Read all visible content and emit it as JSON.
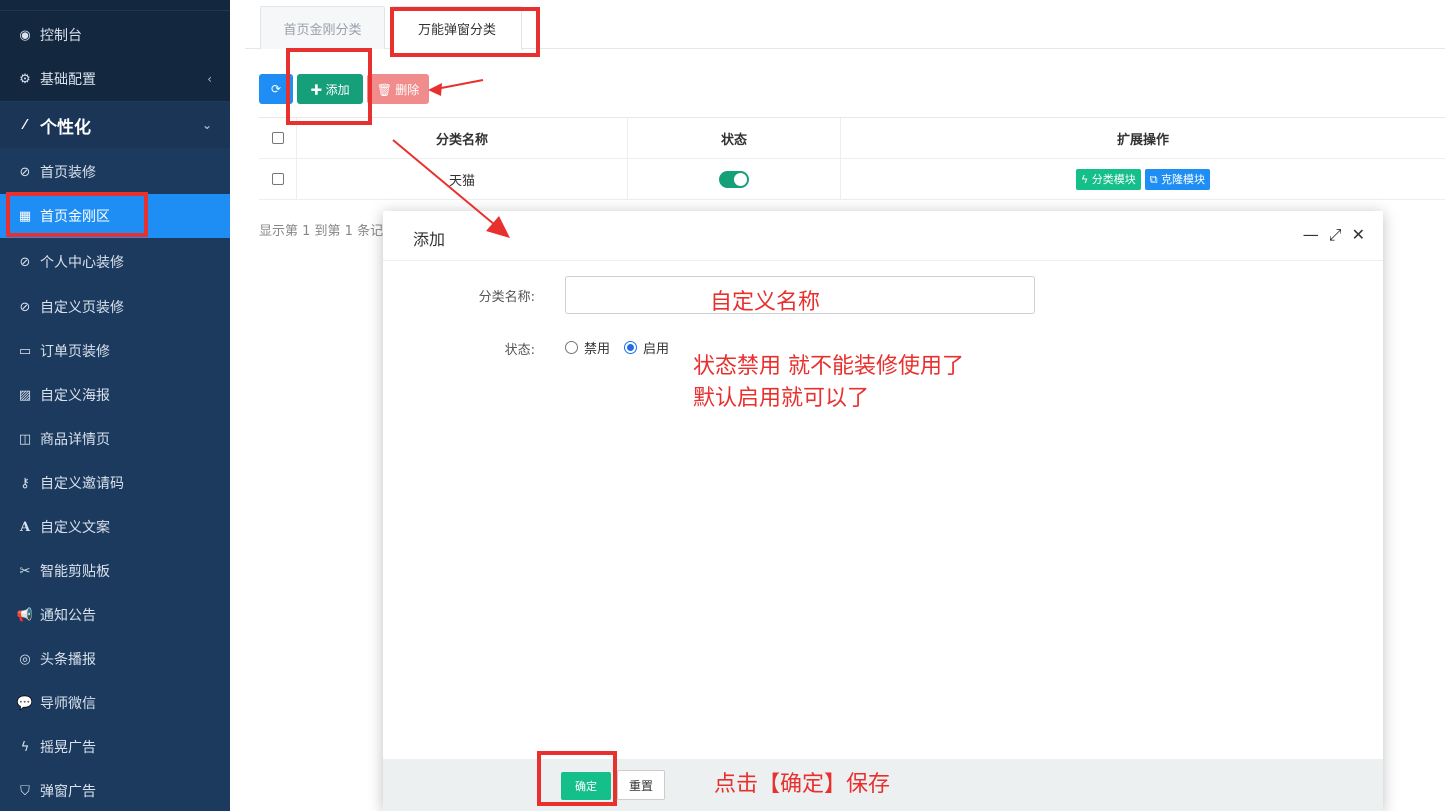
{
  "sidebar": {
    "items": [
      {
        "label": "控制台",
        "icon": "dashboard-icon",
        "glyph": "◉"
      },
      {
        "label": "基础配置",
        "icon": "cogs-icon",
        "glyph": "⚙"
      },
      {
        "label": "个性化",
        "icon": "magic-wand-icon",
        "glyph": "⁄"
      },
      {
        "label": "首页装修",
        "icon": "compass-icon",
        "glyph": "⊘"
      },
      {
        "label": "首页金刚区",
        "icon": "grid-icon",
        "glyph": "▦"
      },
      {
        "label": "个人中心装修",
        "icon": "compass-icon",
        "glyph": "⊘"
      },
      {
        "label": "自定义页装修",
        "icon": "compass-icon",
        "glyph": "⊘"
      },
      {
        "label": "订单页装修",
        "icon": "window-icon",
        "glyph": "▭"
      },
      {
        "label": "自定义海报",
        "icon": "image-icon",
        "glyph": "▨"
      },
      {
        "label": "商品详情页",
        "icon": "columns-icon",
        "glyph": "◫"
      },
      {
        "label": "自定义邀请码",
        "icon": "key-icon",
        "glyph": "⚷"
      },
      {
        "label": "自定义文案",
        "icon": "font-icon",
        "glyph": "A"
      },
      {
        "label": "智能剪贴板",
        "icon": "scissors-icon",
        "glyph": "✂"
      },
      {
        "label": "通知公告",
        "icon": "bullhorn-icon",
        "glyph": "📢"
      },
      {
        "label": "头条播报",
        "icon": "podcast-icon",
        "glyph": "◎"
      },
      {
        "label": "导师微信",
        "icon": "wechat-icon",
        "glyph": "💬"
      },
      {
        "label": "摇晃广告",
        "icon": "bolt-icon",
        "glyph": "ϟ"
      },
      {
        "label": "弹窗广告",
        "icon": "shield-icon",
        "glyph": "⛉"
      }
    ]
  },
  "tabs": [
    {
      "label": "首页金刚分类"
    },
    {
      "label": "万能弹窗分类"
    }
  ],
  "toolbar": {
    "refresh_glyph": "⟳",
    "add_label": "✚ 添加",
    "delete_label": "🗑 删除"
  },
  "table": {
    "headers": [
      "分类名称",
      "状态",
      "扩展操作"
    ],
    "rows": [
      {
        "name": "天猫",
        "status": "on",
        "actions": [
          "ϟ 分类模块",
          "⧉ 克隆模块"
        ]
      }
    ],
    "pager": "显示第 1 到第 1 条记"
  },
  "modal": {
    "title": "添加",
    "min_glyph": "—",
    "max_glyph": "⤢",
    "close_glyph": "✕",
    "name_label": "分类名称:",
    "name_value": "",
    "status_label": "状态:",
    "status_options": [
      "禁用",
      "启用"
    ],
    "status_selected": "启用",
    "ok_label": "确定",
    "reset_label": "重置"
  },
  "annotations": {
    "name_note": "自定义名称",
    "status_note_1": "状态禁用  就不能装修使用了",
    "status_note_2": "默认启用就可以了",
    "save_note": "点击【确定】保存"
  },
  "colors": {
    "sidebar_bg": "#1c3a5e",
    "active_blue": "#1e8ef5",
    "success_green": "#15a079",
    "danger_pink": "#f08c8c",
    "annotation_red": "#e8302e"
  }
}
